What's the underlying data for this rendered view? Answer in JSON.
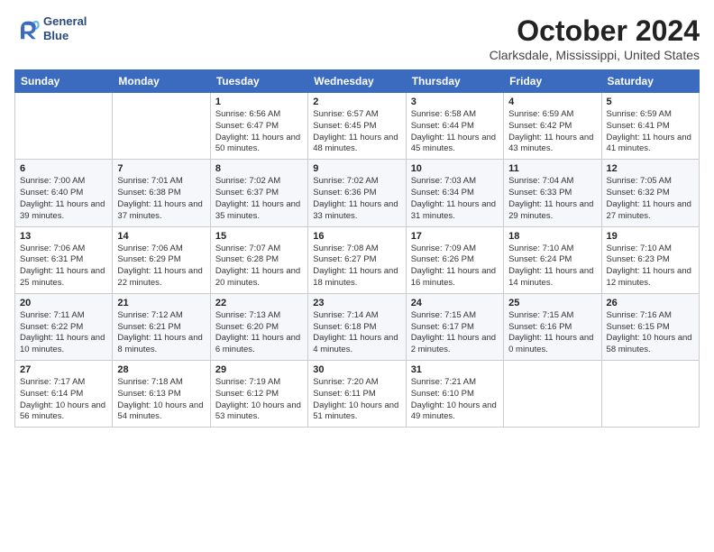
{
  "header": {
    "logo_line1": "General",
    "logo_line2": "Blue",
    "month": "October 2024",
    "location": "Clarksdale, Mississippi, United States"
  },
  "days_of_week": [
    "Sunday",
    "Monday",
    "Tuesday",
    "Wednesday",
    "Thursday",
    "Friday",
    "Saturday"
  ],
  "weeks": [
    [
      {
        "num": "",
        "info": ""
      },
      {
        "num": "",
        "info": ""
      },
      {
        "num": "1",
        "info": "Sunrise: 6:56 AM\nSunset: 6:47 PM\nDaylight: 11 hours and 50 minutes."
      },
      {
        "num": "2",
        "info": "Sunrise: 6:57 AM\nSunset: 6:45 PM\nDaylight: 11 hours and 48 minutes."
      },
      {
        "num": "3",
        "info": "Sunrise: 6:58 AM\nSunset: 6:44 PM\nDaylight: 11 hours and 45 minutes."
      },
      {
        "num": "4",
        "info": "Sunrise: 6:59 AM\nSunset: 6:42 PM\nDaylight: 11 hours and 43 minutes."
      },
      {
        "num": "5",
        "info": "Sunrise: 6:59 AM\nSunset: 6:41 PM\nDaylight: 11 hours and 41 minutes."
      }
    ],
    [
      {
        "num": "6",
        "info": "Sunrise: 7:00 AM\nSunset: 6:40 PM\nDaylight: 11 hours and 39 minutes."
      },
      {
        "num": "7",
        "info": "Sunrise: 7:01 AM\nSunset: 6:38 PM\nDaylight: 11 hours and 37 minutes."
      },
      {
        "num": "8",
        "info": "Sunrise: 7:02 AM\nSunset: 6:37 PM\nDaylight: 11 hours and 35 minutes."
      },
      {
        "num": "9",
        "info": "Sunrise: 7:02 AM\nSunset: 6:36 PM\nDaylight: 11 hours and 33 minutes."
      },
      {
        "num": "10",
        "info": "Sunrise: 7:03 AM\nSunset: 6:34 PM\nDaylight: 11 hours and 31 minutes."
      },
      {
        "num": "11",
        "info": "Sunrise: 7:04 AM\nSunset: 6:33 PM\nDaylight: 11 hours and 29 minutes."
      },
      {
        "num": "12",
        "info": "Sunrise: 7:05 AM\nSunset: 6:32 PM\nDaylight: 11 hours and 27 minutes."
      }
    ],
    [
      {
        "num": "13",
        "info": "Sunrise: 7:06 AM\nSunset: 6:31 PM\nDaylight: 11 hours and 25 minutes."
      },
      {
        "num": "14",
        "info": "Sunrise: 7:06 AM\nSunset: 6:29 PM\nDaylight: 11 hours and 22 minutes."
      },
      {
        "num": "15",
        "info": "Sunrise: 7:07 AM\nSunset: 6:28 PM\nDaylight: 11 hours and 20 minutes."
      },
      {
        "num": "16",
        "info": "Sunrise: 7:08 AM\nSunset: 6:27 PM\nDaylight: 11 hours and 18 minutes."
      },
      {
        "num": "17",
        "info": "Sunrise: 7:09 AM\nSunset: 6:26 PM\nDaylight: 11 hours and 16 minutes."
      },
      {
        "num": "18",
        "info": "Sunrise: 7:10 AM\nSunset: 6:24 PM\nDaylight: 11 hours and 14 minutes."
      },
      {
        "num": "19",
        "info": "Sunrise: 7:10 AM\nSunset: 6:23 PM\nDaylight: 11 hours and 12 minutes."
      }
    ],
    [
      {
        "num": "20",
        "info": "Sunrise: 7:11 AM\nSunset: 6:22 PM\nDaylight: 11 hours and 10 minutes."
      },
      {
        "num": "21",
        "info": "Sunrise: 7:12 AM\nSunset: 6:21 PM\nDaylight: 11 hours and 8 minutes."
      },
      {
        "num": "22",
        "info": "Sunrise: 7:13 AM\nSunset: 6:20 PM\nDaylight: 11 hours and 6 minutes."
      },
      {
        "num": "23",
        "info": "Sunrise: 7:14 AM\nSunset: 6:18 PM\nDaylight: 11 hours and 4 minutes."
      },
      {
        "num": "24",
        "info": "Sunrise: 7:15 AM\nSunset: 6:17 PM\nDaylight: 11 hours and 2 minutes."
      },
      {
        "num": "25",
        "info": "Sunrise: 7:15 AM\nSunset: 6:16 PM\nDaylight: 11 hours and 0 minutes."
      },
      {
        "num": "26",
        "info": "Sunrise: 7:16 AM\nSunset: 6:15 PM\nDaylight: 10 hours and 58 minutes."
      }
    ],
    [
      {
        "num": "27",
        "info": "Sunrise: 7:17 AM\nSunset: 6:14 PM\nDaylight: 10 hours and 56 minutes."
      },
      {
        "num": "28",
        "info": "Sunrise: 7:18 AM\nSunset: 6:13 PM\nDaylight: 10 hours and 54 minutes."
      },
      {
        "num": "29",
        "info": "Sunrise: 7:19 AM\nSunset: 6:12 PM\nDaylight: 10 hours and 53 minutes."
      },
      {
        "num": "30",
        "info": "Sunrise: 7:20 AM\nSunset: 6:11 PM\nDaylight: 10 hours and 51 minutes."
      },
      {
        "num": "31",
        "info": "Sunrise: 7:21 AM\nSunset: 6:10 PM\nDaylight: 10 hours and 49 minutes."
      },
      {
        "num": "",
        "info": ""
      },
      {
        "num": "",
        "info": ""
      }
    ]
  ]
}
